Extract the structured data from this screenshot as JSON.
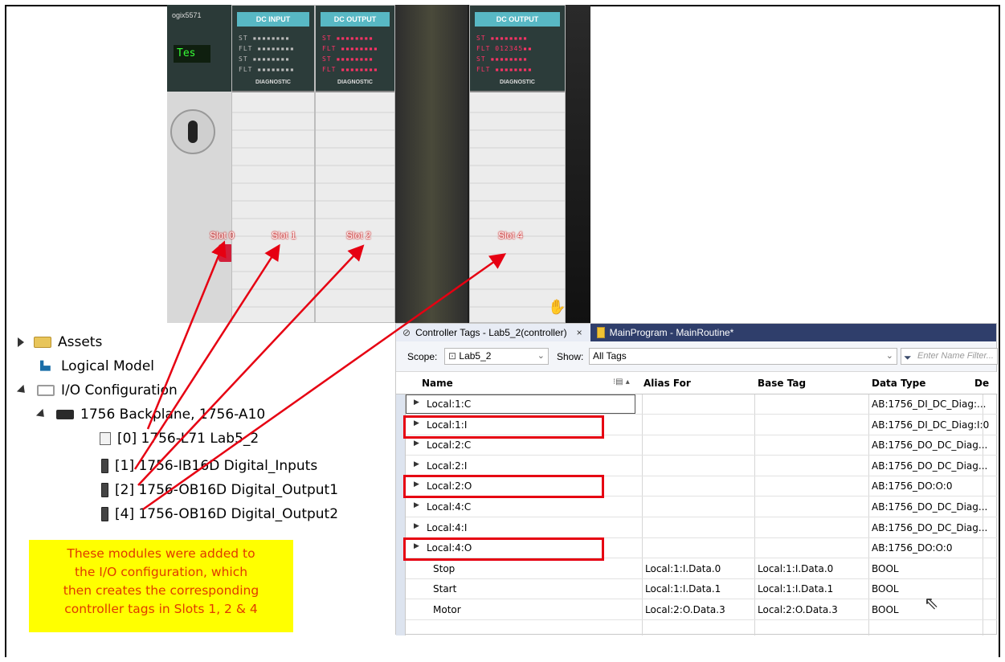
{
  "photo": {
    "cpu_label": "ogix5571",
    "cpu_display": "Tes",
    "modules": [
      {
        "label": "DC INPUT",
        "leds": "ST ▪▪▪▪▪▪▪▪\nFLT ▪▪▪▪▪▪▪▪\nST ▪▪▪▪▪▪▪▪\nFLT ▪▪▪▪▪▪▪▪",
        "diag": "DIAGNOSTIC"
      },
      {
        "label": "DC OUTPUT",
        "leds": "ST ▪▪▪▪▪▪▪▪\nFLT ▪▪▪▪▪▪▪▪\nST ▪▪▪▪▪▪▪▪\nFLT ▪▪▪▪▪▪▪▪",
        "diag": "DIAGNOSTIC"
      },
      {
        "label": "DC OUTPUT",
        "leds": "ST ▪▪▪▪▪▪▪▪\nFLT 012345▪▪\nST ▪▪▪▪▪▪▪▪\nFLT ▪▪▪▪▪▪▪▪",
        "diag": "DIAGNOSTIC"
      }
    ],
    "slot_tags": [
      "Slot 0",
      "Slot 1",
      "Slot 2",
      "Slot 4"
    ]
  },
  "tree": {
    "items": [
      {
        "label": "Assets",
        "icon": "folder-icon"
      },
      {
        "label": "Logical Model",
        "icon": "logical-model-icon"
      },
      {
        "label": "I/O Configuration",
        "icon": "folder-open-icon"
      },
      {
        "label": "1756 Backplane, 1756-A10",
        "icon": "backplane-icon"
      },
      {
        "label": "[0] 1756-L71 Lab5_2",
        "icon": "controller-icon"
      },
      {
        "label": "[1] 1756-IB16D Digital_Inputs",
        "icon": "module-icon"
      },
      {
        "label": "[2] 1756-OB16D Digital_Output1",
        "icon": "module-icon"
      },
      {
        "label": "[4] 1756-OB16D Digital_Output2",
        "icon": "module-icon"
      }
    ]
  },
  "note": {
    "lines": [
      "These modules were added to",
      "the I/O configuration, which",
      "then creates the corresponding",
      "controller tags in Slots 1, 2 & 4"
    ]
  },
  "window": {
    "tabs": [
      {
        "label": "Controller Tags - Lab5_2(controller)",
        "close": "×"
      },
      {
        "label": "MainProgram - MainRoutine*"
      }
    ],
    "scope_label": "Scope:",
    "scope_value": "Lab5_2",
    "show_label": "Show:",
    "show_value": "All Tags",
    "filter_placeholder": "Enter Name Filter..."
  },
  "table": {
    "columns": [
      "Name",
      "Alias For",
      "Base Tag",
      "Data Type",
      "De"
    ],
    "rows": [
      {
        "name": "Local:1:C",
        "alias": "",
        "base": "",
        "type": "AB:1756_DI_DC_Diag:...",
        "expandable": true
      },
      {
        "name": "Local:1:I",
        "alias": "",
        "base": "",
        "type": "AB:1756_DI_DC_Diag:I:0",
        "expandable": true
      },
      {
        "name": "Local:2:C",
        "alias": "",
        "base": "",
        "type": "AB:1756_DO_DC_Diag...",
        "expandable": true
      },
      {
        "name": "Local:2:I",
        "alias": "",
        "base": "",
        "type": "AB:1756_DO_DC_Diag...",
        "expandable": true
      },
      {
        "name": "Local:2:O",
        "alias": "",
        "base": "",
        "type": "AB:1756_DO:O:0",
        "expandable": true
      },
      {
        "name": "Local:4:C",
        "alias": "",
        "base": "",
        "type": "AB:1756_DO_DC_Diag...",
        "expandable": true
      },
      {
        "name": "Local:4:I",
        "alias": "",
        "base": "",
        "type": "AB:1756_DO_DC_Diag...",
        "expandable": true
      },
      {
        "name": "Local:4:O",
        "alias": "",
        "base": "",
        "type": "AB:1756_DO:O:0",
        "expandable": true
      },
      {
        "name": "Stop",
        "alias": "Local:1:I.Data.0",
        "base": "Local:1:I.Data.0",
        "type": "BOOL",
        "expandable": false
      },
      {
        "name": "Start",
        "alias": "Local:1:I.Data.1",
        "base": "Local:1:I.Data.1",
        "type": "BOOL",
        "expandable": false
      },
      {
        "name": "Motor",
        "alias": "Local:2:O.Data.3",
        "base": "Local:2:O.Data.3",
        "type": "BOOL",
        "expandable": false
      }
    ]
  },
  "colors": {
    "highlight": "#e60012",
    "note_bg": "#ffff00",
    "note_text": "#e03a00",
    "tabbar": "#2f3e6b"
  }
}
